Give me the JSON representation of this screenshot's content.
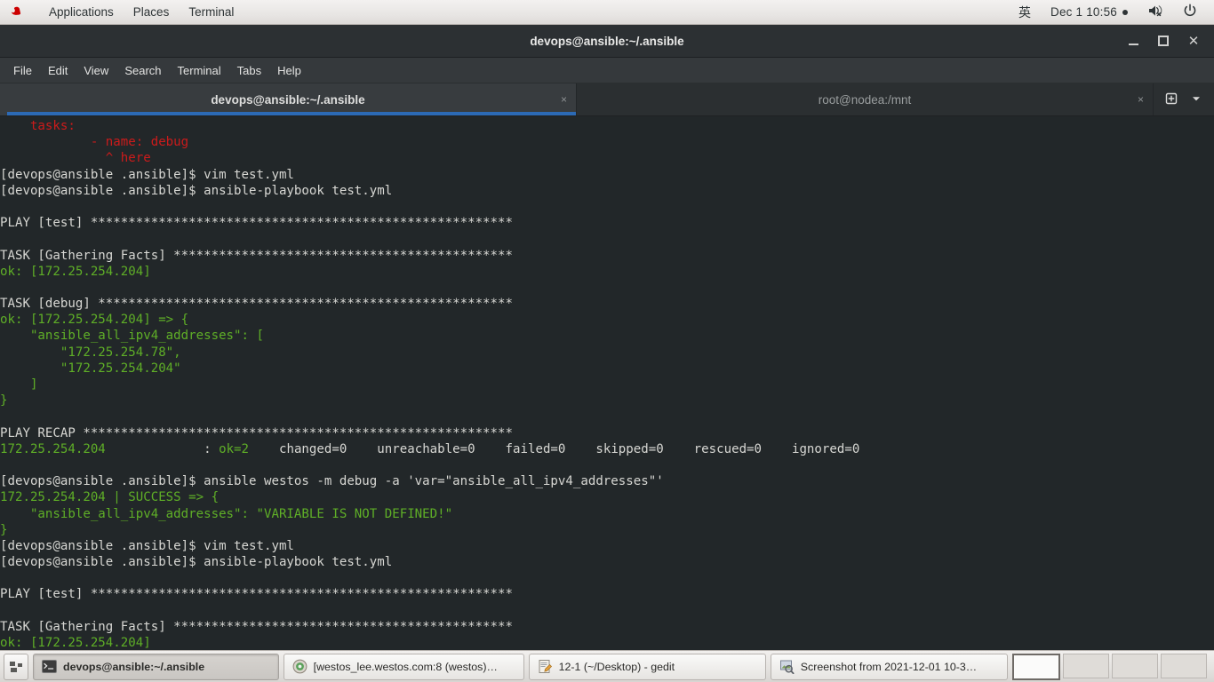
{
  "top_panel": {
    "logo_name": "redhat-logo",
    "menus": [
      "Applications",
      "Places",
      "Terminal"
    ],
    "input_method": "英",
    "clock": "Dec 1 10:56",
    "volume_icon": "volume-muted-icon",
    "power_icon": "power-icon"
  },
  "window": {
    "title": "devops@ansible:~/.ansible",
    "minimize_label": "Minimize",
    "maximize_label": "Maximize",
    "close_label": "Close"
  },
  "menu_bar": {
    "items": [
      "File",
      "Edit",
      "View",
      "Search",
      "Terminal",
      "Tabs",
      "Help"
    ]
  },
  "tabs": {
    "items": [
      {
        "label": "devops@ansible:~/.ansible",
        "active": true,
        "close": "×"
      },
      {
        "label": "root@nodea:/mnt",
        "active": false,
        "close": "×"
      }
    ],
    "new_tab_icon": "new-tab-icon",
    "menu_icon": "chevron-down-icon"
  },
  "terminal": {
    "colors": {
      "background": "#222729",
      "foreground": "#d7d7d3",
      "green": "#5faf27",
      "red": "#cc1b1b",
      "accent": "#2c6ab5"
    },
    "lines": [
      {
        "color": "red",
        "text": "    tasks:"
      },
      {
        "color": "red",
        "text": "            - name: debug"
      },
      {
        "color": "red",
        "text": "              ^ here"
      },
      {
        "color": "white",
        "text": "[devops@ansible .ansible]$ vim test.yml"
      },
      {
        "color": "white",
        "text": "[devops@ansible .ansible]$ ansible-playbook test.yml"
      },
      {
        "color": "white",
        "text": ""
      },
      {
        "color": "white",
        "text": "PLAY [test] ********************************************************"
      },
      {
        "color": "white",
        "text": ""
      },
      {
        "color": "white",
        "text": "TASK [Gathering Facts] *********************************************"
      },
      {
        "color": "green",
        "text": "ok: [172.25.254.204]"
      },
      {
        "color": "white",
        "text": ""
      },
      {
        "color": "white",
        "text": "TASK [debug] *******************************************************"
      },
      {
        "color": "green",
        "text": "ok: [172.25.254.204] => {"
      },
      {
        "color": "green",
        "text": "    \"ansible_all_ipv4_addresses\": ["
      },
      {
        "color": "green",
        "text": "        \"172.25.254.78\","
      },
      {
        "color": "green",
        "text": "        \"172.25.254.204\""
      },
      {
        "color": "green",
        "text": "    ]"
      },
      {
        "color": "green",
        "text": "}"
      },
      {
        "color": "white",
        "text": ""
      },
      {
        "color": "white",
        "text": "PLAY RECAP *********************************************************"
      },
      {
        "color": "recap",
        "text": "172.25.254.204             : ok=2    changed=0    unreachable=0    failed=0    skipped=0    rescued=0    ignored=0"
      },
      {
        "color": "white",
        "text": ""
      },
      {
        "color": "white",
        "text": "[devops@ansible .ansible]$ ansible westos -m debug -a 'var=\"ansible_all_ipv4_addresses\"'"
      },
      {
        "color": "green",
        "text": "172.25.254.204 | SUCCESS => {"
      },
      {
        "color": "green",
        "text": "    \"ansible_all_ipv4_addresses\": \"VARIABLE IS NOT DEFINED!\""
      },
      {
        "color": "green",
        "text": "}"
      },
      {
        "color": "white",
        "text": "[devops@ansible .ansible]$ vim test.yml"
      },
      {
        "color": "white",
        "text": "[devops@ansible .ansible]$ ansible-playbook test.yml"
      },
      {
        "color": "white",
        "text": ""
      },
      {
        "color": "white",
        "text": "PLAY [test] ********************************************************"
      },
      {
        "color": "white",
        "text": ""
      },
      {
        "color": "white",
        "text": "TASK [Gathering Facts] *********************************************"
      },
      {
        "color": "green",
        "text": "ok: [172.25.254.204]"
      }
    ],
    "recap_parts": {
      "host": "172.25.254.204",
      "pad": "             : ",
      "ok": "ok=2",
      "rest": "    changed=0    unreachable=0    failed=0    skipped=0    rescued=0    ignored=0"
    }
  },
  "taskbar": {
    "show_desktop_label": "Show Desktop",
    "tasks": [
      {
        "icon": "terminal-icon",
        "label": "devops@ansible:~/.ansible",
        "active": true
      },
      {
        "icon": "browser-icon",
        "label": "[westos_lee.westos.com:8 (westos)…",
        "active": false
      },
      {
        "icon": "gedit-icon",
        "label": "12-1 (~/Desktop) - gedit",
        "active": false
      },
      {
        "icon": "image-viewer-icon",
        "label": "Screenshot from 2021-12-01 10-3…",
        "active": false
      }
    ],
    "workspaces": [
      {
        "name": "workspace-1",
        "active": true
      },
      {
        "name": "workspace-2",
        "active": false
      },
      {
        "name": "workspace-3",
        "active": false
      },
      {
        "name": "workspace-4",
        "active": false
      }
    ]
  }
}
